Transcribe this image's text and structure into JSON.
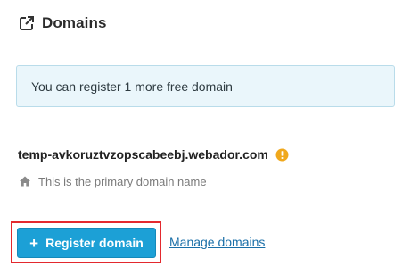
{
  "header": {
    "icon": "external-link-icon",
    "title": "Domains"
  },
  "info": {
    "message": "You can register 1 more free domain"
  },
  "domain": {
    "name": "temp-avkoruztvzopscabeebj.webador.com",
    "warning_icon": "exclamation-circle-icon",
    "warning_color": "#f0a81c",
    "primary_icon": "home-icon",
    "primary_text": "This is the primary domain name"
  },
  "actions": {
    "register_label": "Register domain",
    "register_icon": "plus-icon",
    "manage_label": "Manage domains"
  },
  "colors": {
    "primary_button": "#1ca0d6",
    "link": "#1a6fa8",
    "info_background": "#eaf6fb",
    "highlight_border": "#e3292e"
  }
}
